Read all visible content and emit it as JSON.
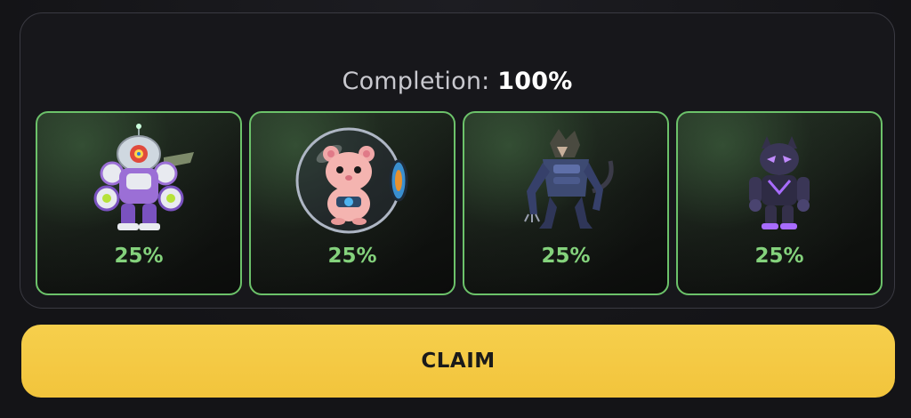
{
  "completion": {
    "label": "Completion:",
    "value": "100%"
  },
  "cards": [
    {
      "icon": "purple-robot-mech-icon",
      "percent": "25%"
    },
    {
      "icon": "hamster-in-ball-icon",
      "percent": "25%"
    },
    {
      "icon": "armored-werewolf-icon",
      "percent": "25%"
    },
    {
      "icon": "purple-panther-warrior-icon",
      "percent": "25%"
    }
  ],
  "claim_button": {
    "label": "CLAIM"
  },
  "colors": {
    "accent_green": "#84d27c",
    "card_border": "#6cc26a",
    "claim_yellow": "#f4c842",
    "background": "#16161a"
  }
}
